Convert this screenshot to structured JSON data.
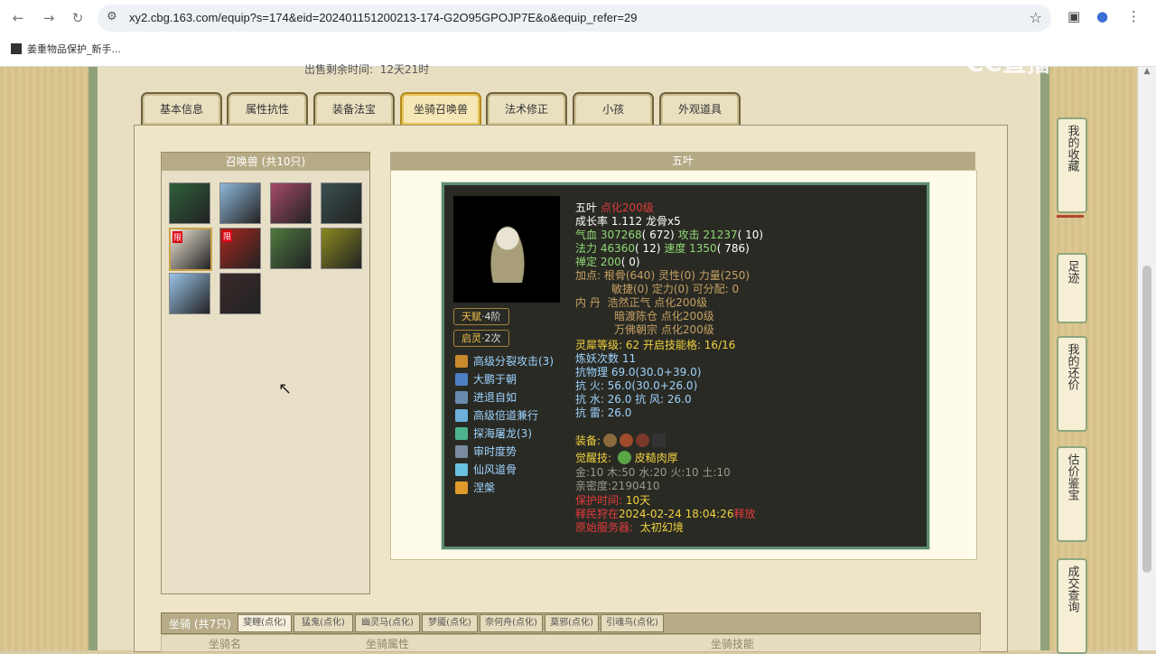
{
  "browser": {
    "url": "xy2.cbg.163.com/equip?s=174&eid=202401151200213-174-G2O95GPOJP7E&o&equip_refer=29",
    "bookmark": "姜重物品保护_新手..."
  },
  "page": {
    "sale_time_label": "出售剩余时间:",
    "sale_time_value": "12天21时",
    "watermark": "CC直播"
  },
  "tabs": [
    "基本信息",
    "属性抗性",
    "装备法宝",
    "坐骑召唤兽",
    "法术修正",
    "小孩",
    "外观道具"
  ],
  "pets": {
    "title": "召唤兽 (共10只)",
    "limit_label": "限",
    "items": [
      {
        "color": "#2f5e3b"
      },
      {
        "color": "#8fb8d9"
      },
      {
        "color": "#a64a6b"
      },
      {
        "color": "#3b5050"
      },
      {
        "color": "#efe6d6",
        "limited": true
      },
      {
        "color": "#a8261c",
        "limited": true
      },
      {
        "color": "#4f7a3e"
      },
      {
        "color": "#8a8a20"
      },
      {
        "color": "#9ac3e8"
      },
      {
        "color": "#3a2a2a"
      }
    ]
  },
  "detail": {
    "title": "五叶",
    "badge_talent": "天赋",
    "badge_talent_sub": "·4阶",
    "badge_spirit": "启灵",
    "badge_spirit_sub": "·2次",
    "skills": [
      "高级分裂攻击(3)",
      "大鹏于朝",
      "进退自如",
      "高级倍道兼行",
      "探海屠龙(3)",
      "审时度势",
      "仙风道骨",
      "涅槃"
    ],
    "name": "五叶",
    "level": "点化200级",
    "growth": "成长率 1.112 龙骨x5",
    "hp_label": "气血",
    "hp": "307268",
    "hp_paren": "( 672)",
    "atk_label": "攻击",
    "atk": "21237",
    "atk_paren": "( 10)",
    "mp_label": "法力",
    "mp": "46360",
    "mp_paren": "( 12)",
    "spd_label": "速度",
    "spd": "1350",
    "spd_paren": "( 786)",
    "zen_label": "禅定",
    "zen": "200",
    "zen_paren": "( 0)",
    "points_line1": "加点:  根骨(640) 灵性(0) 力量(250)",
    "points_line2": "敏捷(0) 定力(0) 可分配:  0",
    "neidan_label": "内    丹",
    "neidan1": "浩然正气 点化200级",
    "neidan2": "暗渡陈仓 点化200级",
    "neidan3": "万佛朝宗 点化200级",
    "spirit_level": "灵犀等级:  62  开启技能格:  16/16",
    "refine": "炼妖次数 11",
    "resist1": "抗物理 69.0(30.0+39.0)",
    "resist2": "抗    火: 56.0(30.0+26.0)",
    "resist3": "抗    水: 26.0 抗    风: 26.0",
    "resist4": "抗    雷: 26.0",
    "equip_label": "装备:",
    "awaken_label": "觉醒技:",
    "awaken": "皮糙肉厚",
    "elements": "金:10 木:50 水:20 火:10 土:10",
    "intimacy": "亲密度:2190410",
    "protect_label": "保护时间:",
    "protect": "10天",
    "release_label": "释民狩在",
    "release": "2024-02-24 18:04:26",
    "release_suffix": "释放",
    "origin_label": "原始服务器:",
    "origin": "太初幻境"
  },
  "right_panel": [
    "我的收藏",
    "足迹",
    "我的还价",
    "估价鉴宝",
    "成交查询"
  ],
  "mounts": {
    "title": "坐骑 (共7只)",
    "tabs": [
      "斐鲤(点化)",
      "猛鬼(点化)",
      "幽灵马(点化)",
      "梦魇(点化)",
      "奈何舟(点化)",
      "莫邪(点化)",
      "引魂鸟(点化)"
    ],
    "col_name": "坐骑名",
    "col_attr": "坐骑属性",
    "col_skill": "坐骑技能"
  }
}
